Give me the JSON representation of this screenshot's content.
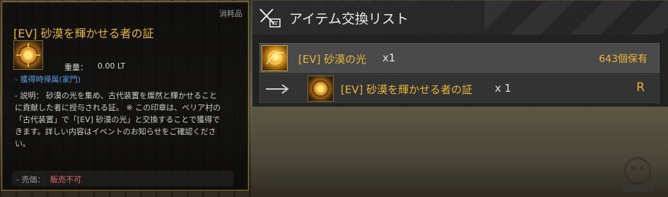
{
  "tooltip": {
    "category": "消耗品",
    "title": "[EV] 砂漠を輝かせる者の証",
    "icon": "sun-medallion-icon",
    "weight_label": "重量：",
    "weight_value": "0.00 LT",
    "acquired": "- 獲得時帰属(家門)",
    "description": "- 説明： 砂漠の光を集め、古代装置を燦然と輝かせること\nに貢献した者に授与される証。 ※ この印章は、ベリア村の\n「古代装置」で「[EV] 砂漠の光」と交換することで獲得で\nきます。詳しい内容はイベントのお知らせをご確認くださ\nい。",
    "price_label": "- 売価：",
    "price_value": "販売不可"
  },
  "exchange": {
    "header_icon": "swords-scroll-icon",
    "title": "アイテム交換リスト",
    "source": {
      "icon": "desert-light-icon",
      "name": "[EV] 砂漠の光",
      "qty": "x1",
      "owned": "643個保有"
    },
    "result": {
      "arrow_icon": "arrow-right-icon",
      "icon": "sun-medallion-icon",
      "name": "[EV] 砂漠を輝かせる者の証",
      "qty": "x 1",
      "grade": "R"
    }
  },
  "colors": {
    "gold": "#e9b43a",
    "blue": "#5a9de2",
    "red": "#e06a6a"
  }
}
